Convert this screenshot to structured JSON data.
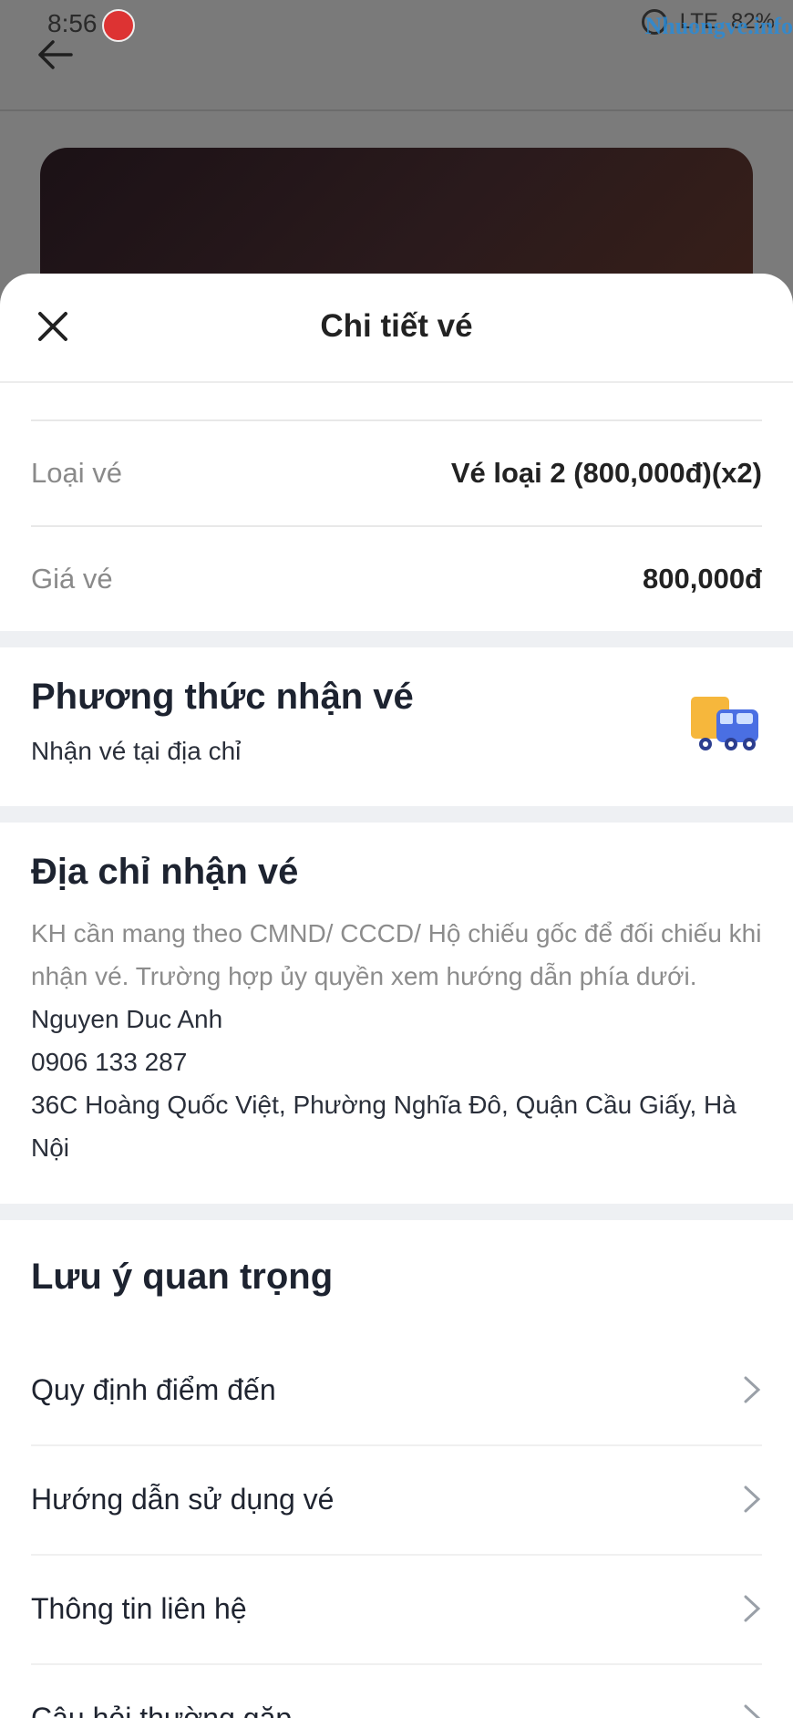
{
  "status_bar": {
    "time": "8:56",
    "network": "LTE",
    "battery": "82%",
    "watermark": "Nhuongve.info"
  },
  "sheet": {
    "title": "Chi tiết vé"
  },
  "ticket": {
    "type_label": "Loại vé",
    "type_value": "Vé loại 2 (800,000đ)(x2)",
    "price_label": "Giá vé",
    "price_value": "800,000đ"
  },
  "delivery": {
    "title": "Phương thức nhận vé",
    "method": "Nhận vé tại địa chỉ",
    "icon": "delivery-truck-icon"
  },
  "address": {
    "title": "Địa chỉ nhận vé",
    "note": "KH cần mang theo CMND/ CCCD/ Hộ chiếu gốc để đối chiếu khi nhận vé. Trường hợp ủy quyền xem hướng dẫn phía dưới.",
    "name": "Nguyen Duc Anh",
    "phone": "0906 133 287",
    "street": "36C Hoàng Quốc Việt, Phường Nghĩa Đô, Quận Cầu Giấy, Hà Nội"
  },
  "notes": {
    "title": "Lưu ý quan trọng",
    "items": [
      {
        "label": "Quy định điểm đến"
      },
      {
        "label": "Hướng dẫn sử dụng vé"
      },
      {
        "label": "Thông tin liên hệ"
      },
      {
        "label": "Câu hỏi thường gặp"
      }
    ]
  },
  "colors": {
    "overlay": "#7a7a7a",
    "gap": "#eef0f3",
    "title_text": "#1d2330",
    "muted_text": "#8c8c8c"
  }
}
